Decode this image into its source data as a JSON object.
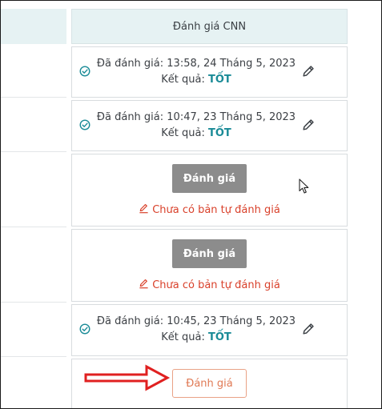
{
  "table": {
    "column_header": "Đánh giá CNN",
    "rows": [
      {
        "status": "evaluated",
        "label": "Đã đánh giá:",
        "datetime": "13:58, 24 Tháng 5, 2023",
        "result_label": "Kết quả:",
        "result": "TỐT"
      },
      {
        "status": "evaluated",
        "label": "Đã đánh giá:",
        "datetime": "10:47, 23 Tháng 5, 2023",
        "result_label": "Kết quả:",
        "result": "TỐT"
      },
      {
        "status": "pending",
        "button_label": "Đánh giá",
        "warning": "Chưa có bản tự đánh giá"
      },
      {
        "status": "pending",
        "button_label": "Đánh giá",
        "warning": "Chưa có bản tự đánh giá"
      },
      {
        "status": "evaluated",
        "label": "Đã đánh giá:",
        "datetime": "10:45, 23 Tháng 5, 2023",
        "result_label": "Kết quả:",
        "result": "TỐT"
      },
      {
        "status": "open",
        "button_label": "Đánh giá"
      }
    ]
  },
  "colors": {
    "header_bg": "#e6f2f3",
    "check_teal": "#1a8b97",
    "result_teal": "#1a8b97",
    "disabled_button": "#8c8c8c",
    "warning_red": "#d9412b",
    "active_button_text": "#e07a55",
    "annotation_arrow": "#e02020"
  },
  "icons": {
    "evaluated_status": "check-circle-icon",
    "edit": "pencil-icon",
    "warning": "edit-note-icon",
    "annotation": "arrow-right-icon",
    "pointer": "mouse-cursor-icon"
  }
}
